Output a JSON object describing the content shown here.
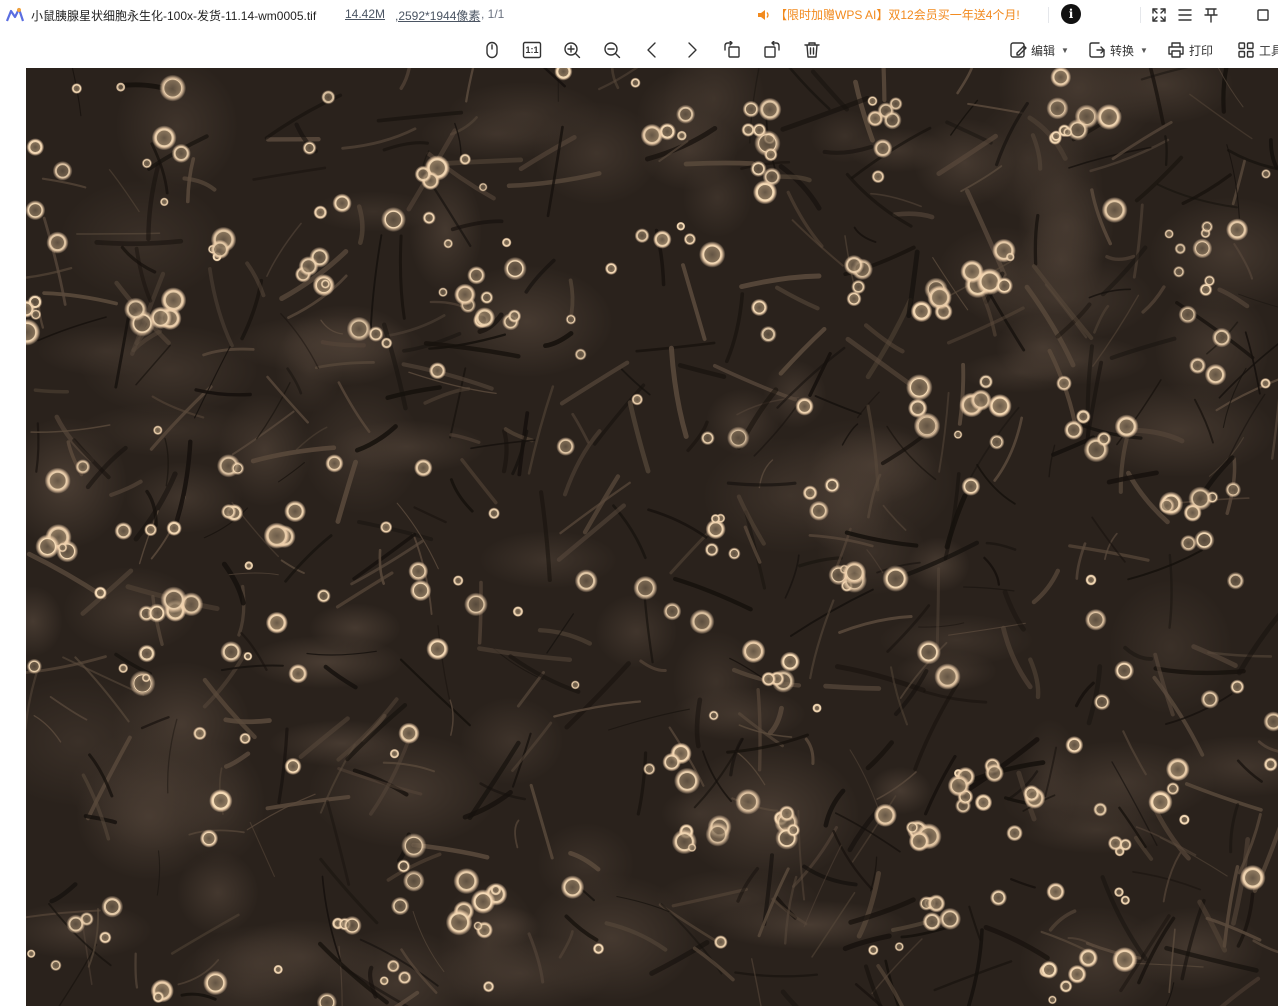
{
  "titlebar": {
    "filename": "小鼠胰腺星状细胞永生化-100x-发货-11.14-wm0005.tif",
    "file_size": "14.42M",
    "dimensions": ",2592*1944像素",
    "page_info": ", 1/1",
    "promo_text": "【限时加赠WPS AI】双12会员买一年送4个月!",
    "avatar_letter": "i"
  },
  "toolbar": {
    "edit_label": "编辑",
    "convert_label": "转换",
    "print_label": "打印",
    "tools_label": "工具",
    "actual_size_label": "1:1"
  },
  "colors": {
    "promo": "#f28a1e",
    "image_background": "#2a221c",
    "cell_highlight": "#f3d2ad"
  },
  "icons": [
    "wps-logo-icon",
    "fullscreen-icon",
    "menu-icon",
    "pin-icon",
    "maximize-icon",
    "mouse-icon",
    "actual-size-icon",
    "zoom-in-icon",
    "zoom-out-icon",
    "previous-icon",
    "next-icon",
    "rotate-left-icon",
    "rotate-right-icon",
    "delete-icon",
    "edit-icon",
    "convert-icon",
    "print-icon",
    "tools-icon",
    "speaker-icon"
  ],
  "image": {
    "description_type": "phase-contrast micrograph"
  }
}
